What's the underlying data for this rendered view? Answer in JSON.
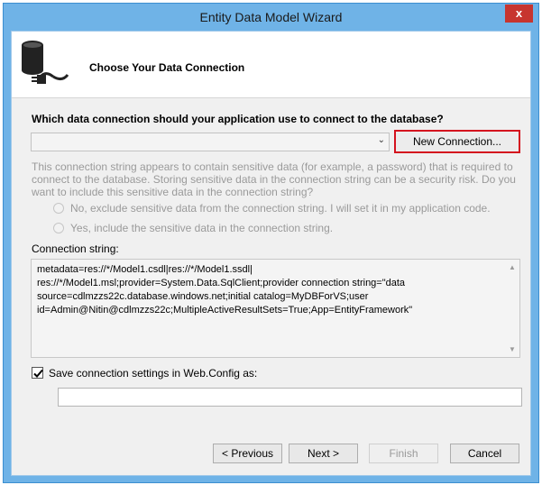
{
  "window": {
    "title": "Entity Data Model Wizard",
    "close_glyph": "x"
  },
  "header": {
    "title": "Choose Your Data Connection",
    "icon": "database-plug-icon"
  },
  "question": "Which data connection should your application use to connect to the database?",
  "connection_select": {
    "selected_value": ""
  },
  "new_connection_button": "New Connection...",
  "sensitive_notice": "This connection string appears to contain sensitive data (for example, a password) that is required to connect to the database. Storing sensitive data in the connection string can be a security risk. Do you want to include this sensitive data in the connection string?",
  "options": {
    "exclude": "No, exclude sensitive data from the connection string. I will set it in my application code.",
    "include": "Yes, include the sensitive data in the connection string."
  },
  "connection_string": {
    "label": "Connection string:",
    "value": "metadata=res://*/Model1.csdl|res://*/Model1.ssdl|\nres://*/Model1.msl;provider=System.Data.SqlClient;provider connection string=\"data source=cdlmzzs22c.database.windows.net;initial catalog=MyDBForVS;user id=Admin@Nitin@cdlmzzs22c;MultipleActiveResultSets=True;App=EntityFramework\""
  },
  "save_settings": {
    "label": "Save connection settings in Web.Config as:",
    "checked": true,
    "value": ""
  },
  "buttons": {
    "previous": "< Previous",
    "next": "Next >",
    "finish": "Finish",
    "cancel": "Cancel"
  },
  "colors": {
    "title_bar": "#6fb3e7",
    "close_button": "#c7352f",
    "highlight_border": "#d4121e",
    "disabled_text": "#9a9a9a"
  }
}
